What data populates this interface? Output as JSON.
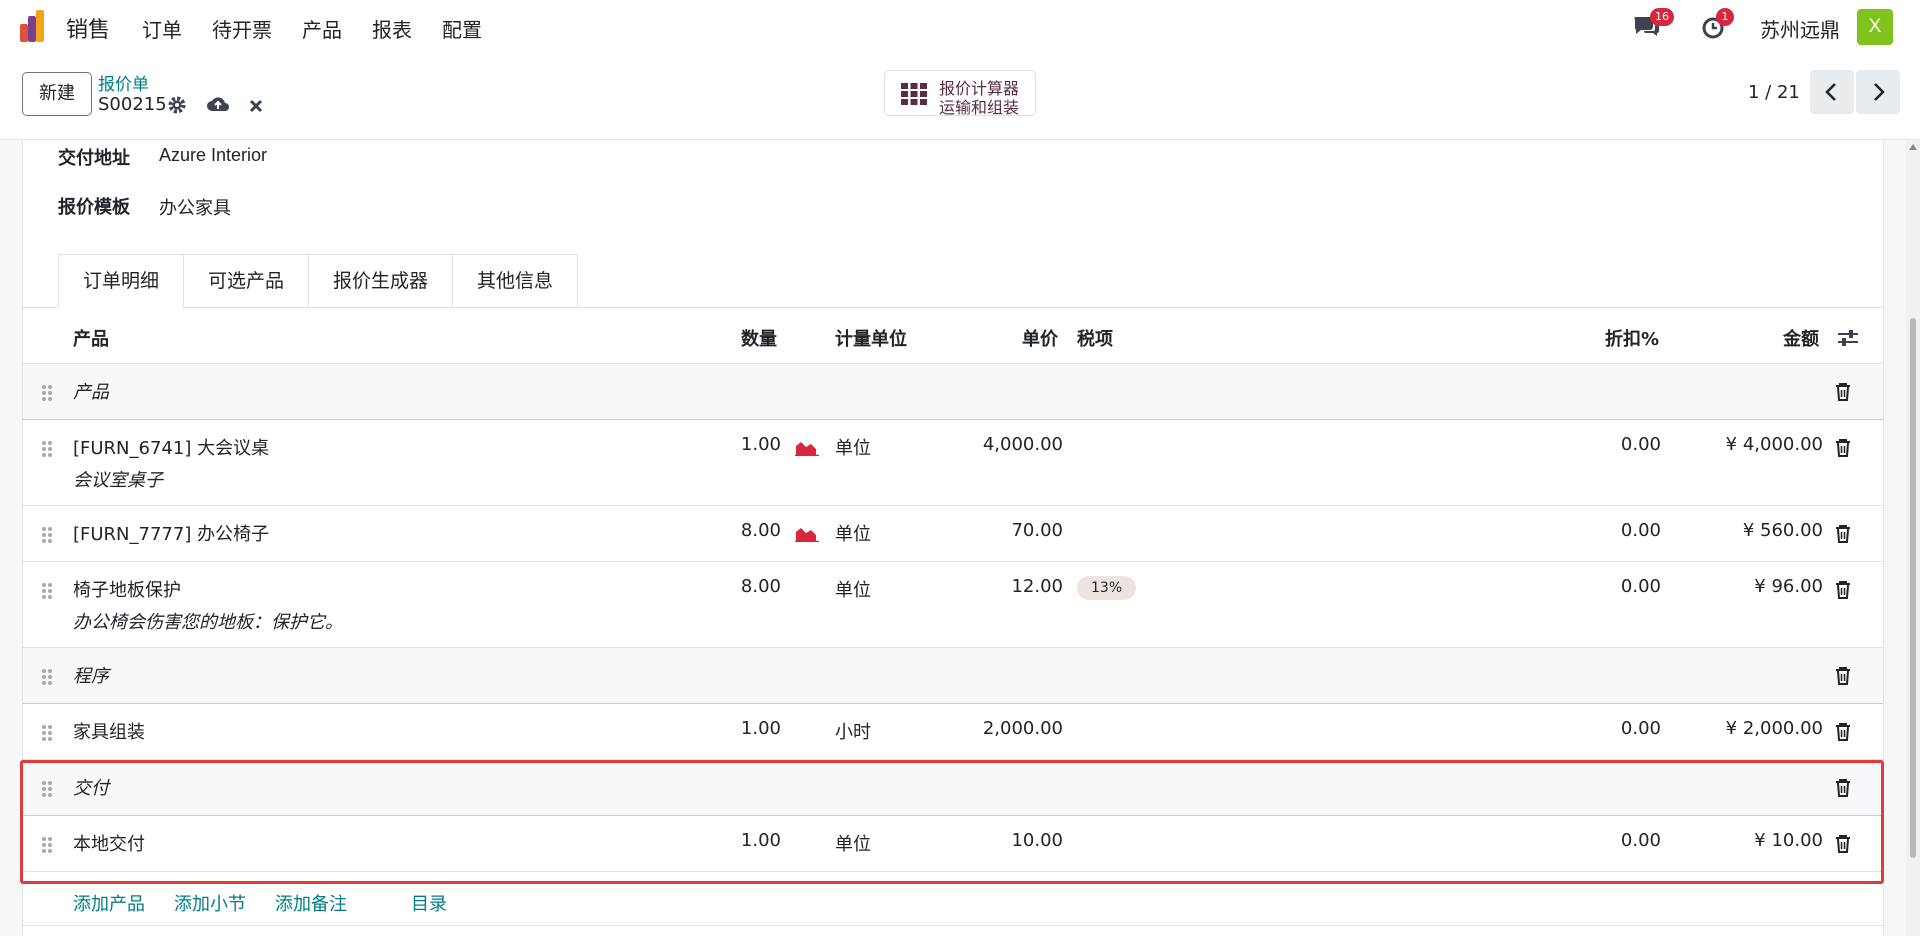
{
  "nav": {
    "brand": "销售",
    "menu": [
      "订单",
      "待开票",
      "产品",
      "报表",
      "配置"
    ],
    "messages_count": "16",
    "activities_count": "1",
    "company": "苏州远鼎",
    "avatar_letter": "X"
  },
  "control": {
    "new_button": "新建",
    "breadcrumb_parent": "报价单",
    "record_name": "S00215",
    "smart_button_line1": "报价计算器",
    "smart_button_line2": "运输和组装",
    "pager": "1 / 21"
  },
  "fields": {
    "delivery_address_label": "交付地址",
    "delivery_address_value": "Azure Interior",
    "quote_template_label": "报价模板",
    "quote_template_value": "办公家具"
  },
  "tabs": [
    "订单明细",
    "可选产品",
    "报价生成器",
    "其他信息"
  ],
  "table": {
    "headers": {
      "product": "产品",
      "qty": "数量",
      "uom": "计量单位",
      "price": "单价",
      "taxes": "税项",
      "discount": "折扣%",
      "amount": "金额"
    },
    "rows": [
      {
        "type": "section",
        "name": "产品"
      },
      {
        "type": "line",
        "name": "[FURN_6741] 大会议桌",
        "desc": "会议室桌子",
        "qty": "1.00",
        "forecast": true,
        "uom": "单位",
        "price": "4,000.00",
        "tax": "",
        "discount": "0.00",
        "amount": "¥ 4,000.00"
      },
      {
        "type": "line",
        "name": "[FURN_7777] 办公椅子",
        "desc": "",
        "qty": "8.00",
        "forecast": true,
        "uom": "单位",
        "price": "70.00",
        "tax": "",
        "discount": "0.00",
        "amount": "¥ 560.00"
      },
      {
        "type": "line",
        "name": "椅子地板保护",
        "desc": "办公椅会伤害您的地板：保护它。",
        "qty": "8.00",
        "forecast": false,
        "uom": "单位",
        "price": "12.00",
        "tax": "13%",
        "discount": "0.00",
        "amount": "¥ 96.00"
      },
      {
        "type": "section",
        "name": "程序"
      },
      {
        "type": "line",
        "name": "家具组装",
        "desc": "",
        "qty": "1.00",
        "forecast": false,
        "uom": "小时",
        "price": "2,000.00",
        "tax": "",
        "discount": "0.00",
        "amount": "¥ 2,000.00"
      },
      {
        "type": "section",
        "name": "交付"
      },
      {
        "type": "line",
        "name": "本地交付",
        "desc": "",
        "qty": "1.00",
        "forecast": false,
        "uom": "单位",
        "price": "10.00",
        "tax": "",
        "discount": "0.00",
        "amount": "¥ 10.00"
      }
    ]
  },
  "add_links": {
    "add_product": "添加产品",
    "add_section": "添加小节",
    "add_note": "添加备注",
    "catalog": "目录"
  },
  "colors": {
    "accent": "#017e84",
    "highlight": "#e03a3a",
    "forecast": "#d7263d"
  }
}
